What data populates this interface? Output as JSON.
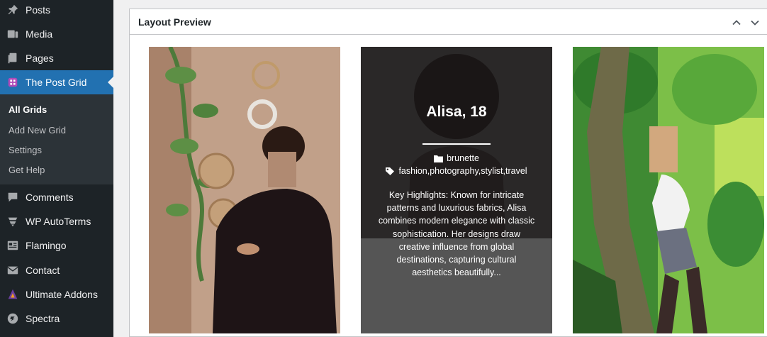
{
  "sidebar": {
    "items": [
      {
        "label": "Posts",
        "icon": "pin-icon"
      },
      {
        "label": "Media",
        "icon": "media-icon"
      },
      {
        "label": "Pages",
        "icon": "pages-icon"
      },
      {
        "label": "The Post Grid",
        "icon": "post-grid-icon"
      },
      {
        "label": "Comments",
        "icon": "comments-icon"
      },
      {
        "label": "WP AutoTerms",
        "icon": "autoterms-icon"
      },
      {
        "label": "Flamingo",
        "icon": "flamingo-icon"
      },
      {
        "label": "Contact",
        "icon": "mail-icon"
      },
      {
        "label": "Ultimate Addons",
        "icon": "ultimate-addons-icon"
      },
      {
        "label": "Spectra",
        "icon": "spectra-icon"
      }
    ],
    "submenu": [
      "All Grids",
      "Add New Grid",
      "Settings",
      "Get Help"
    ]
  },
  "panel": {
    "title": "Layout Preview"
  },
  "cards": [
    {
      "title": "",
      "image": "woman in black turtleneck"
    },
    {
      "title": "Alisa, 18",
      "category": "brunette",
      "tags": "fashion,photography,stylist,travel",
      "excerpt": "Key Highlights: Known for intricate patterns and luxurious fabrics, Alisa combines modern elegance with classic sophistication. Her designs draw creative influence from global destinations, capturing cultural aesthetics beautifully..."
    },
    {
      "title": "",
      "image": "woman by tree"
    }
  ],
  "colors": {
    "sidebar_bg": "#1d2327",
    "submenu_bg": "#2c3338",
    "active_bg": "#2271b1",
    "panel_bg": "#ffffff"
  }
}
